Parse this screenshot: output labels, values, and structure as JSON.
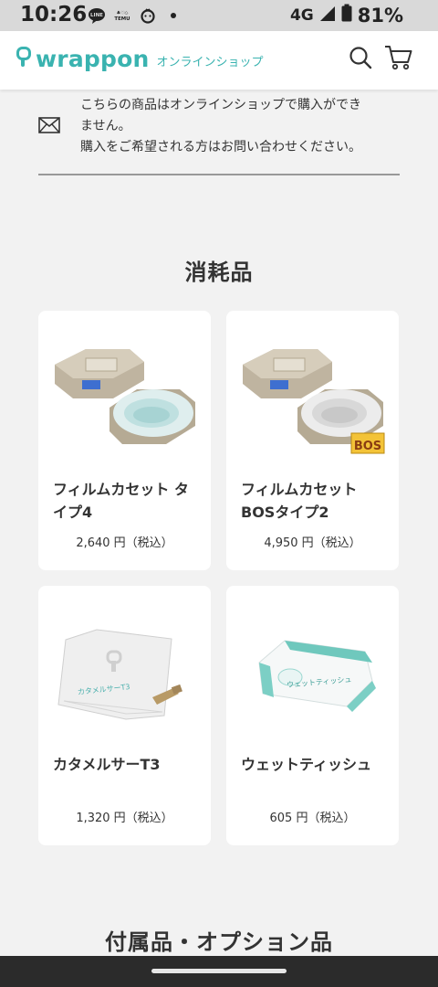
{
  "status_bar": {
    "time": "10:26",
    "app_icons": [
      "line-icon",
      "temu-icon",
      "baby-icon",
      "dot-icon"
    ],
    "network": "4G",
    "battery": "81%"
  },
  "header": {
    "logo_text": "wrappon",
    "logo_subtitle": "オンラインショップ",
    "brand_color": "#3ab3b0"
  },
  "notice": {
    "lines": [
      "こちらの商品はオンラインショップで購入ができ",
      "ません。",
      "購入をご希望される方はお問い合わせください。"
    ]
  },
  "sections": [
    {
      "title": "消耗品"
    },
    {
      "title": "付属品・オプション品"
    }
  ],
  "products": [
    {
      "name_lines": [
        "フィルムカセット タ",
        "イプ4"
      ],
      "price": "2,640 円（税込）",
      "image": "film-cassette-type4-image"
    },
    {
      "name_lines": [
        "フィルムカセット",
        "BOSタイプ2"
      ],
      "price": "4,950 円（税込）",
      "image": "film-cassette-bos-type2-image",
      "badge": "BOS"
    },
    {
      "name_lines": [
        "カタメルサーT3",
        ""
      ],
      "price": "1,320 円（税込）",
      "image": "katamerusa-t3-image",
      "package_text": "カタメルサーT3"
    },
    {
      "name_lines": [
        "ウェットティッシュ",
        ""
      ],
      "price": "605 円（税込）",
      "image": "wet-tissue-image",
      "package_text": "ウェットティッシュ"
    }
  ]
}
